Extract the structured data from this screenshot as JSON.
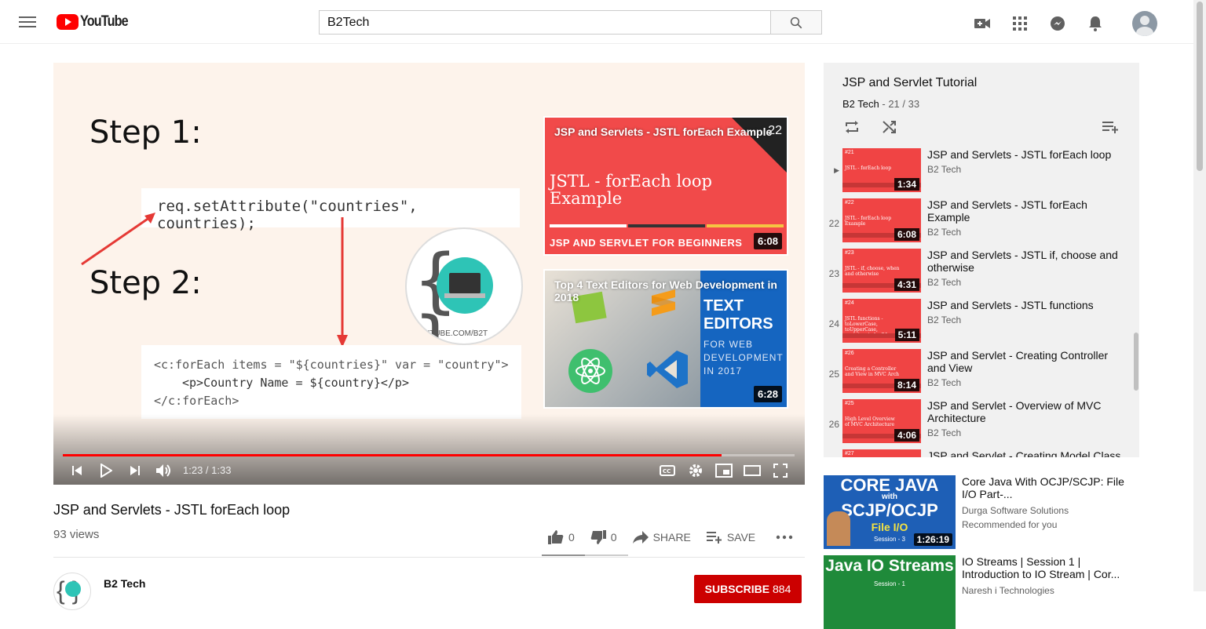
{
  "header": {
    "logo_text": "YouTube",
    "search_value": "B2Tech",
    "icons": [
      "menu-icon",
      "upload-video-icon",
      "apps-icon",
      "messages-icon",
      "notifications-icon",
      "account-avatar"
    ]
  },
  "player": {
    "slide": {
      "step1": "Step 1:",
      "step2": "Step 2:",
      "code1": "req.setAttribute(\"countries\", countries);",
      "code2a": "<c:forEach items = \"${countries}\" var = \"country\">",
      "code2b": "<p>Country Name = ${country}</p>",
      "code2c": "</c:forEach>",
      "watermark": "UTUBE.COM/B2T"
    },
    "endcards": [
      {
        "title": "JSP and Servlets - JSTL forEach Example",
        "big_text": "JSTL - forEach loop Example",
        "bottom_text": "JSP AND SERVLET FOR BEGINNERS",
        "number": "22",
        "duration": "6:08"
      },
      {
        "title": "Top 4 Text Editors for Web Development in 2018",
        "big_text": "TEXT EDITORS",
        "sub_text": "FOR WEB DEVELOPMENT IN 2017",
        "duration": "6:28"
      }
    ],
    "time_current": "1:23",
    "time_total": "1:33",
    "time_display": "1:23 / 1:33",
    "progress": 0.9,
    "progress_color": "#ff0000"
  },
  "video": {
    "title": "JSP and Servlets - JSTL forEach loop",
    "views": "93 views",
    "likes": "0",
    "dislikes": "0",
    "share_label": "SHARE",
    "save_label": "SAVE",
    "channel": "B2 Tech",
    "subscribe_label": "SUBSCRIBE",
    "subscriber_count": "884"
  },
  "playlist": {
    "title": "JSP and Servlet Tutorial",
    "channel": "B2 Tech",
    "position": "21 / 33",
    "items": [
      {
        "index": "▶",
        "title": "JSP and Servlets - JSTL forEach loop",
        "channel": "B2 Tech",
        "duration": "1:34",
        "tag": "#21",
        "thumb_text": "JSTL - forEach loop"
      },
      {
        "index": "22",
        "title": "JSP and Servlets - JSTL forEach Example",
        "channel": "B2 Tech",
        "duration": "6:08",
        "tag": "#22",
        "thumb_text": "JSTL - forEach loop Example"
      },
      {
        "index": "23",
        "title": "JSP and Servlets - JSTL if, choose and otherwise",
        "channel": "B2 Tech",
        "duration": "4:31",
        "tag": "#23",
        "thumb_text": "JSTL - if, choose, when and otherwise"
      },
      {
        "index": "24",
        "title": "JSP and Servlets - JSTL functions",
        "channel": "B2 Tech",
        "duration": "5:11",
        "tag": "#24",
        "thumb_text": "JSTL functions - toLowerCase, toUpperCase, contains, indexOf"
      },
      {
        "index": "25",
        "title": "JSP and Servlet - Creating Controller and View",
        "channel": "B2 Tech",
        "duration": "8:14",
        "tag": "#26",
        "thumb_text": "Creating a Controller and View in MVC Arch"
      },
      {
        "index": "26",
        "title": "JSP and Servlet - Overview of MVC Architecture",
        "channel": "B2 Tech",
        "duration": "4:06",
        "tag": "#25",
        "thumb_text": "High Level Overview of MVC Architecture"
      },
      {
        "index": "",
        "title": "JSP and Servlet - Creating Model Class",
        "channel": "",
        "duration": "",
        "tag": "#27",
        "thumb_text": ""
      }
    ]
  },
  "recommendations": [
    {
      "title": "Core Java With OCJP/SCJP: File I/O Part-...",
      "channel": "Durga Software Solutions",
      "note": "Recommended for you",
      "duration": "1:26:19",
      "thumb_line1": "CORE JAVA",
      "thumb_line2": "with",
      "thumb_line3": "SCJP/OCJP",
      "thumb_line4": "File I/O",
      "thumb_line5": "Session - 3"
    },
    {
      "title": "IO Streams | Session 1 | Introduction to IO Stream | Cor...",
      "channel": "Naresh i Technologies",
      "note": "",
      "duration": "",
      "thumb_line1": "Java IO Streams",
      "thumb_line2": "Session - 1"
    }
  ]
}
